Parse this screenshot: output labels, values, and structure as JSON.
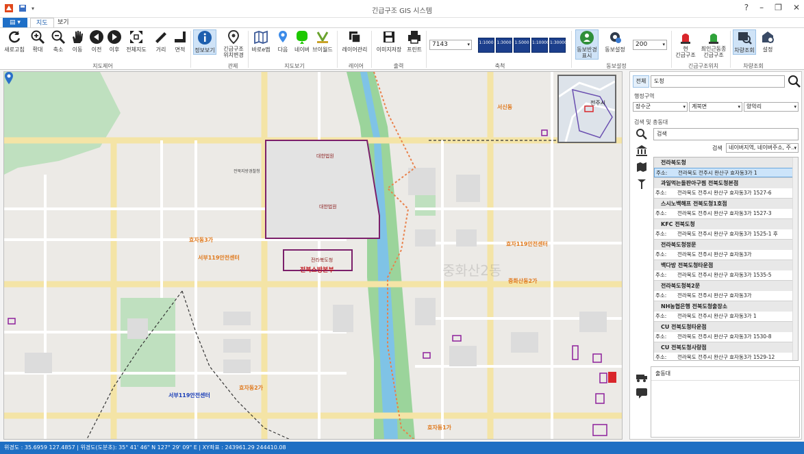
{
  "window": {
    "title": "긴급구조 GIS 시스템"
  },
  "menu": {
    "file_label": "",
    "tabs": [
      "지도",
      "보기"
    ]
  },
  "ribbon": {
    "buttons": [
      {
        "id": "refresh",
        "label": "새로고침"
      },
      {
        "id": "zoom-in",
        "label": "확대"
      },
      {
        "id": "zoom-out",
        "label": "축소"
      },
      {
        "id": "pan",
        "label": "이동"
      },
      {
        "id": "prev",
        "label": "이전"
      },
      {
        "id": "next",
        "label": "이후"
      },
      {
        "id": "full",
        "label": "전체지도"
      },
      {
        "id": "distance",
        "label": "거리"
      },
      {
        "id": "area",
        "label": "면적"
      },
      {
        "id": "info",
        "label": "정보보기"
      },
      {
        "id": "emergency-loc",
        "label": "긴급구조\n위치변경"
      },
      {
        "id": "base-map",
        "label": "바로e맵"
      },
      {
        "id": "daum",
        "label": "다음"
      },
      {
        "id": "naver",
        "label": "네이버"
      },
      {
        "id": "vworld",
        "label": "브이월드"
      },
      {
        "id": "layer",
        "label": "레이어관리"
      },
      {
        "id": "save-image",
        "label": "이미지저장"
      },
      {
        "id": "print",
        "label": "프린트"
      },
      {
        "id": "radius-display",
        "label": "동보반경\n표시"
      },
      {
        "id": "radius-setting",
        "label": "동보설정"
      },
      {
        "id": "current-rescue",
        "label": "현\n긴급구조"
      },
      {
        "id": "last-rescue",
        "label": "최인근동종\n긴급구조"
      },
      {
        "id": "vehicle-search",
        "label": "차량조회"
      },
      {
        "id": "setting",
        "label": "설정"
      }
    ],
    "groups": [
      "지도제어",
      "관제",
      "지도보기",
      "레이어",
      "출력",
      "축척",
      "동보설정",
      "긴급구조위치",
      "차량조회"
    ],
    "scale_value": "7143",
    "scale_buttons": [
      "1:1000",
      "1:3000",
      "1:5000",
      "1:10000",
      "1:30000"
    ],
    "radius_value": "200"
  },
  "map": {
    "labels": {
      "station_east": "효자119안전센터",
      "station_west": "서부119안전센터",
      "station_west2": "서부119안전센터",
      "hq": "전북소방본부",
      "hq_sub": "전라북도청",
      "dong3": "효자동3가",
      "dong2": "효자동2가",
      "dong1": "효자동1가",
      "jungwha": "중화산동2가",
      "seosin": "서신동",
      "jeonju": "전주시",
      "police": "전북지방경찰청",
      "admin1": "대한법원",
      "admin2": "대한법원",
      "watermark": "중화산2동"
    }
  },
  "panel": {
    "tab_all": "전체",
    "search_value": "도청",
    "admin_label": "행정구역",
    "admin_selects": [
      "장수군",
      "계북면",
      "양악리"
    ],
    "search_label": "검색 및 총동대",
    "search2_placeholder": "검색",
    "search_type_label": "검색",
    "search_type_value": "네이버지역, 네이버주소, 주...",
    "results": [
      {
        "name": "전라북도청",
        "key": "주소:",
        "addr": "전라북도 전주시 완산구 효자동3가 1",
        "selected": true
      },
      {
        "name": "과일먹는돌판아구찜 전북도청본점",
        "key": "주소:",
        "addr": "전라북도 전주시 완산구 효자동3가 1527-6",
        "selected": false
      },
      {
        "name": "스시노백해프 전북도청1호점",
        "key": "주소:",
        "addr": "전라북도 전주시 완산구 효자동3가 1527-3",
        "selected": false
      },
      {
        "name": "KFC 전북도청",
        "key": "주소:",
        "addr": "전라북도 전주시 완산구 효자동3가 1525-1 후",
        "selected": false
      },
      {
        "name": "전라북도청정문",
        "key": "주소:",
        "addr": "전라북도 전주시 완산구 효자동3가",
        "selected": false
      },
      {
        "name": "백다방 전북도청타운점",
        "key": "주소:",
        "addr": "전라북도 전주시 완산구 효자동3가 1535-5",
        "selected": false
      },
      {
        "name": "전라북도청북2문",
        "key": "주소:",
        "addr": "전라북도 전주시 완산구 효자동3가",
        "selected": false
      },
      {
        "name": "NH농협은행 전북도청출장소",
        "key": "주소:",
        "addr": "전라북도 전주시 완산구 효자동3가 1",
        "selected": false
      },
      {
        "name": "CU 전북도청타운점",
        "key": "주소:",
        "addr": "전라북도 전주시 완산구 효자동3가 1530-8",
        "selected": false
      },
      {
        "name": "CU 전북도청사랑점",
        "key": "주소:",
        "addr": "전라북도 전주시 완산구 효자동3가 1529-12",
        "selected": false
      }
    ],
    "lower_label": "출동대"
  },
  "status": {
    "text": "위경도 : 35.6959 127.4857 | 위경도(도분초): 35° 41' 46\" N 127° 29' 09\" E | XY좌표 : 243961.29 244410.08"
  },
  "colors": {
    "ribbon_accent": "#1e6fc7",
    "status_bar": "#1f6fc3",
    "selection": "#cce4fa"
  }
}
